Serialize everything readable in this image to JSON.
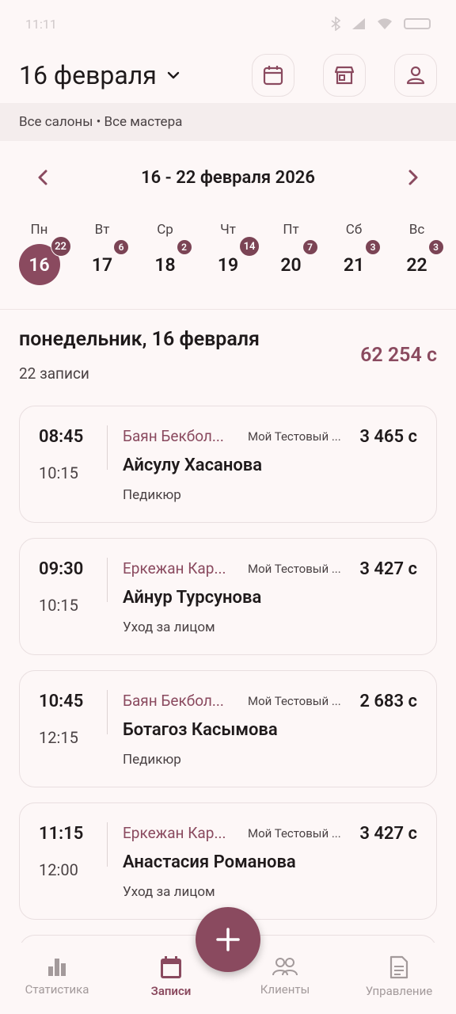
{
  "status_bar": {
    "time": "11:11"
  },
  "header": {
    "title": "16 февраля"
  },
  "filter": {
    "text": "Все салоны • Все мастера"
  },
  "week": {
    "range": "16 - 22 февраля 2026"
  },
  "days": [
    {
      "wd": "Пн",
      "num": "16",
      "badge": "22",
      "active": true
    },
    {
      "wd": "Вт",
      "num": "17",
      "badge": "6"
    },
    {
      "wd": "Ср",
      "num": "18",
      "badge": "2"
    },
    {
      "wd": "Чт",
      "num": "19",
      "badge": "14"
    },
    {
      "wd": "Пт",
      "num": "20",
      "badge": "7"
    },
    {
      "wd": "Сб",
      "num": "21",
      "badge": "3"
    },
    {
      "wd": "Вс",
      "num": "22",
      "badge": "3"
    }
  ],
  "day_summary": {
    "name": "понедельник, 16 февраля",
    "count": "22 записи",
    "total": "62 254 с"
  },
  "appointments": [
    {
      "start": "08:45",
      "end": "10:15",
      "master": "Баян Бекбол...",
      "salon": "Мой Тестовый ...",
      "price": "3 465 с",
      "client": "Айсулу Хасанова",
      "service": "Педикюр"
    },
    {
      "start": "09:30",
      "end": "10:15",
      "master": "Еркежан Кар...",
      "salon": "Мой Тестовый ...",
      "price": "3 427 с",
      "client": "Айнур Турсунова",
      "service": "Уход за лицом"
    },
    {
      "start": "10:45",
      "end": "12:15",
      "master": "Баян Бекбол...",
      "salon": "Мой Тестовый ...",
      "price": "2 683 с",
      "client": "Ботагоз Касымова",
      "service": "Педикюр"
    },
    {
      "start": "11:15",
      "end": "12:00",
      "master": "Еркежан Кар...",
      "salon": "Мой Тестовый ...",
      "price": "3 427 с",
      "client": "Анастасия Романова",
      "service": "Уход за лицом"
    }
  ],
  "nav": [
    {
      "label": "Статистика",
      "icon": "bar-chart-icon"
    },
    {
      "label": "Записи",
      "icon": "calendar-icon",
      "active": true
    },
    {
      "label": "Клиенты",
      "icon": "people-icon"
    },
    {
      "label": "Управление",
      "icon": "document-icon"
    }
  ],
  "colors": {
    "accent": "#8a4a5f",
    "background": "#fdf7f7",
    "filter_bg": "#f4eded",
    "badge": "#7b4455"
  }
}
